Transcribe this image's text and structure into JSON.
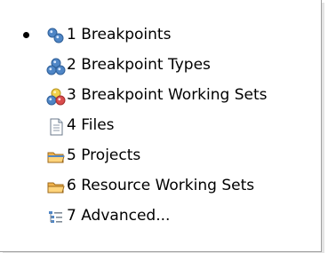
{
  "menu": {
    "items": [
      {
        "label": "1 Breakpoints",
        "icon": "breakpoints-icon",
        "selected": true
      },
      {
        "label": "2 Breakpoint Types",
        "icon": "breakpoint-types-icon",
        "selected": false
      },
      {
        "label": "3 Breakpoint Working Sets",
        "icon": "breakpoint-working-sets-icon",
        "selected": false
      },
      {
        "label": "4 Files",
        "icon": "file-icon",
        "selected": false
      },
      {
        "label": "5 Projects",
        "icon": "projects-folder-icon",
        "selected": false
      },
      {
        "label": "6 Resource Working Sets",
        "icon": "resource-folder-icon",
        "selected": false
      },
      {
        "label": "7 Advanced...",
        "icon": "advanced-tree-icon",
        "selected": false
      }
    ]
  },
  "colors": {
    "blue": "#4f86c6",
    "orange": "#f0b24a",
    "red": "#d94d4d",
    "yellow": "#f1d14b",
    "gray": "#7f8a96",
    "text": "#000000"
  }
}
